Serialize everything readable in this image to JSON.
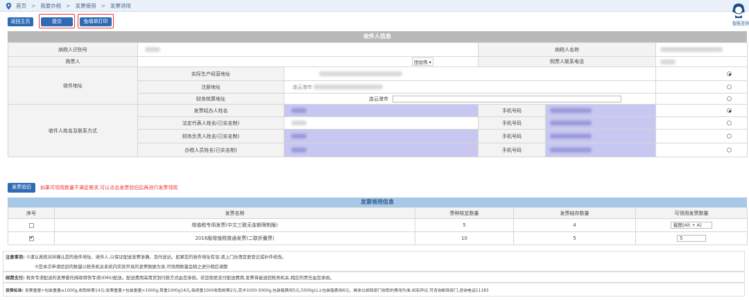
{
  "breadcrumb": [
    "首页",
    "我要办税",
    "发票使用",
    "发票领用"
  ],
  "help_label": "智能咨询",
  "toolbar": {
    "back": "返回主页",
    "submit": "提交",
    "print": "免填单打印"
  },
  "recipient": {
    "title": "收件人信息",
    "taxpayer_id_label": "纳税人识别号",
    "taxpayer_name_label": "纳税人名称",
    "buyer_label": "购票人",
    "buyer_select": "田加伟 ▾",
    "buyer_phone_label": "购票人联系电话",
    "address_label": "收件地址",
    "addr_rows": [
      {
        "label": "实际生产经营地址",
        "value": ""
      },
      {
        "label": "注册地址",
        "value": "连云港市"
      },
      {
        "label": "财务核算地址",
        "value": "连云港市"
      }
    ],
    "contact_label": "收件人姓名及联系方式",
    "contact_rows": [
      {
        "label": "发票经办人姓名",
        "phone_label": "手机号码"
      },
      {
        "label": "法定代表人姓名(已实名制)",
        "phone_label": "手机号码"
      },
      {
        "label": "财务负责人姓名(已实名制)",
        "phone_label": "手机号码"
      },
      {
        "label": "办税人员姓名(已实名制)",
        "phone_label": "手机号码"
      }
    ]
  },
  "verify": {
    "button": "发票验旧",
    "hint": "如果可领用数量不满足需求,可以点击发票验旧后再进行发票领用"
  },
  "invoice": {
    "title": "发票领用信息",
    "headers": [
      "序号",
      "发票名称",
      "票种核定数量",
      "发票结存数量",
      "可领用发票数量"
    ],
    "rows": [
      {
        "name": "增值税专用发票(中文三联无金额限制版)",
        "approved": "5",
        "stock": "4",
        "input": "截图(Alt + A)",
        "checked": false
      },
      {
        "name": "2016版增值税普通发票(二联折叠票)",
        "approved": "10",
        "stock": "5",
        "input": "5",
        "checked": true
      }
    ]
  },
  "notes": {
    "label1": "注意事项:",
    "line1": "①请认真核对并确认您的收件地址、收件人,以保证配送发票准确、及时送达。如果您的收件地址有误,请上门办理变更登记或补件修改。",
    "line2": "②您本次申请验旧的数量以税务机关系统内实际开具的发票数据为准,可领用数量会随之进行相应调整",
    "label2": "邮费支付:",
    "line3": "税务专递配送的发票委托邮政特快专递(EMS)配送。配送费用采用货到付款方式由您承担。若您拒绝支付配送费用,发票将被退回税务机关,相应的责任由您承担。",
    "label3": "资费标准:",
    "line4": "发票重量+包装重量≤1000g,收取邮费14元;发票重量+包装重量>1000g,首重1000g14元,每续重1000收取邮费2元,其中1000-5000g,包装箱费用5元,5000g以上包装箱费用6元。具体以邮政部门收取的费用为准,如有异议,可咨询邮政部门,咨询电话11183"
  }
}
